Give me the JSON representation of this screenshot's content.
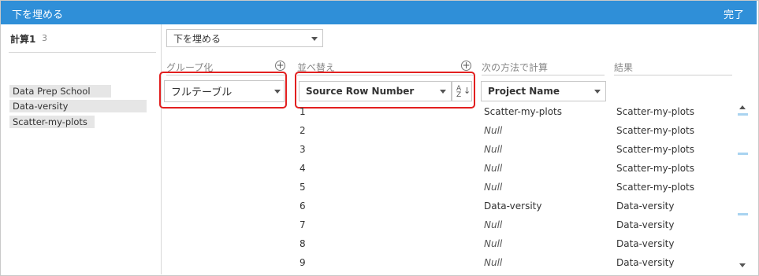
{
  "titlebar": {
    "title": "下を埋める",
    "done_label": "完了"
  },
  "left_panel": {
    "calc_label": "計算1",
    "calc_count": "3",
    "values": [
      "Data Prep School",
      "Data-versity",
      "Scatter-my-plots"
    ]
  },
  "operation": {
    "selected": "下を埋める"
  },
  "columns": {
    "group": {
      "header": "グループ化",
      "selected": "フルテーブル"
    },
    "sort": {
      "header": "並べ替え",
      "selected": "Source Row Number"
    },
    "compute": {
      "header": "次の方法で計算",
      "selected": "Project Name"
    },
    "result": {
      "header": "結果"
    }
  },
  "rows": [
    {
      "row": "1",
      "compute": "Scatter-my-plots",
      "result": "Scatter-my-plots"
    },
    {
      "row": "2",
      "compute": "Null",
      "result": "Scatter-my-plots"
    },
    {
      "row": "3",
      "compute": "Null",
      "result": "Scatter-my-plots"
    },
    {
      "row": "4",
      "compute": "Null",
      "result": "Scatter-my-plots"
    },
    {
      "row": "5",
      "compute": "Null",
      "result": "Scatter-my-plots"
    },
    {
      "row": "6",
      "compute": "Data-versity",
      "result": "Data-versity"
    },
    {
      "row": "7",
      "compute": "Null",
      "result": "Data-versity"
    },
    {
      "row": "8",
      "compute": "Null",
      "result": "Data-versity"
    },
    {
      "row": "9",
      "compute": "Null",
      "result": "Data-versity"
    }
  ],
  "colors": {
    "titlebar": "#2f8fd8",
    "highlight": "#e21f1f",
    "chip": "#e6e6e6"
  }
}
